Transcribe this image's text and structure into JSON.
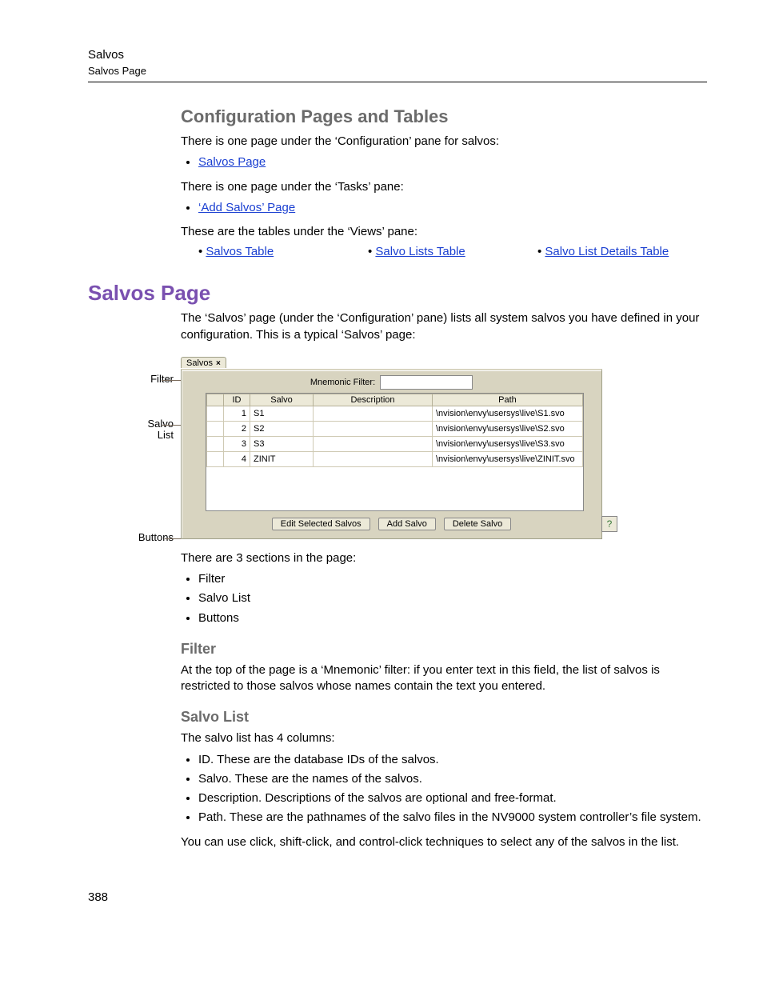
{
  "header": {
    "title": "Salvos",
    "subtitle": "Salvos Page"
  },
  "section_cfg": {
    "heading": "Configuration Pages and Tables",
    "p1": "There is one page under the ‘Configuration’ pane for salvos:",
    "link1": "Salvos Page",
    "p2": "There is one page under the ‘Tasks’ pane:",
    "link2": "‘Add Salvos’ Page",
    "p3": "These are the tables under the ‘Views’ pane:",
    "views_links": [
      "Salvos Table",
      "Salvo Lists Table",
      "Salvo List Details Table"
    ]
  },
  "section_salvos": {
    "heading": "Salvos Page",
    "intro": "The ‘Salvos’ page (under the ‘Configuration’ pane) lists all system salvos you have defined in your configuration. This is a typical ‘Salvos’ page:"
  },
  "figure": {
    "tab_label": "Salvos",
    "filter_label": "Mnemonic Filter:",
    "columns": [
      "ID",
      "Salvo",
      "Description",
      "Path"
    ],
    "rows": [
      {
        "id": "1",
        "salvo": "S1",
        "desc": "",
        "path": "\\nvision\\envy\\usersys\\live\\S1.svo"
      },
      {
        "id": "2",
        "salvo": "S2",
        "desc": "",
        "path": "\\nvision\\envy\\usersys\\live\\S2.svo"
      },
      {
        "id": "3",
        "salvo": "S3",
        "desc": "",
        "path": "\\nvision\\envy\\usersys\\live\\S3.svo"
      },
      {
        "id": "4",
        "salvo": "ZINIT",
        "desc": "",
        "path": "\\nvision\\envy\\usersys\\live\\ZINIT.svo"
      }
    ],
    "buttons": [
      "Edit Selected Salvos",
      "Add Salvo",
      "Delete Salvo"
    ],
    "callouts": {
      "filter": "Filter",
      "list1": "Salvo",
      "list2": "List",
      "buttons": "Buttons"
    }
  },
  "after_fig": {
    "p1": "There are 3 sections in the page:",
    "items": [
      "Filter",
      "Salvo List",
      "Buttons"
    ]
  },
  "filter_section": {
    "heading": "Filter",
    "p": "At the top of the page is a ‘Mnemonic’ filter: if you enter text in this field, the list of salvos is restricted to those salvos whose names contain the text you entered."
  },
  "list_section": {
    "heading": "Salvo List",
    "p1": "The salvo list has 4 columns:",
    "items": [
      "ID. These are the database IDs of the salvos.",
      "Salvo. These are the names of the salvos.",
      "Description. Descriptions of the salvos are optional and free-format.",
      "Path. These are the pathnames of the salvo files in the NV9000 system controller’s file system."
    ],
    "p2": "You can use click, shift-click, and control-click techniques to select any of the salvos in the list."
  },
  "page_number": "388"
}
